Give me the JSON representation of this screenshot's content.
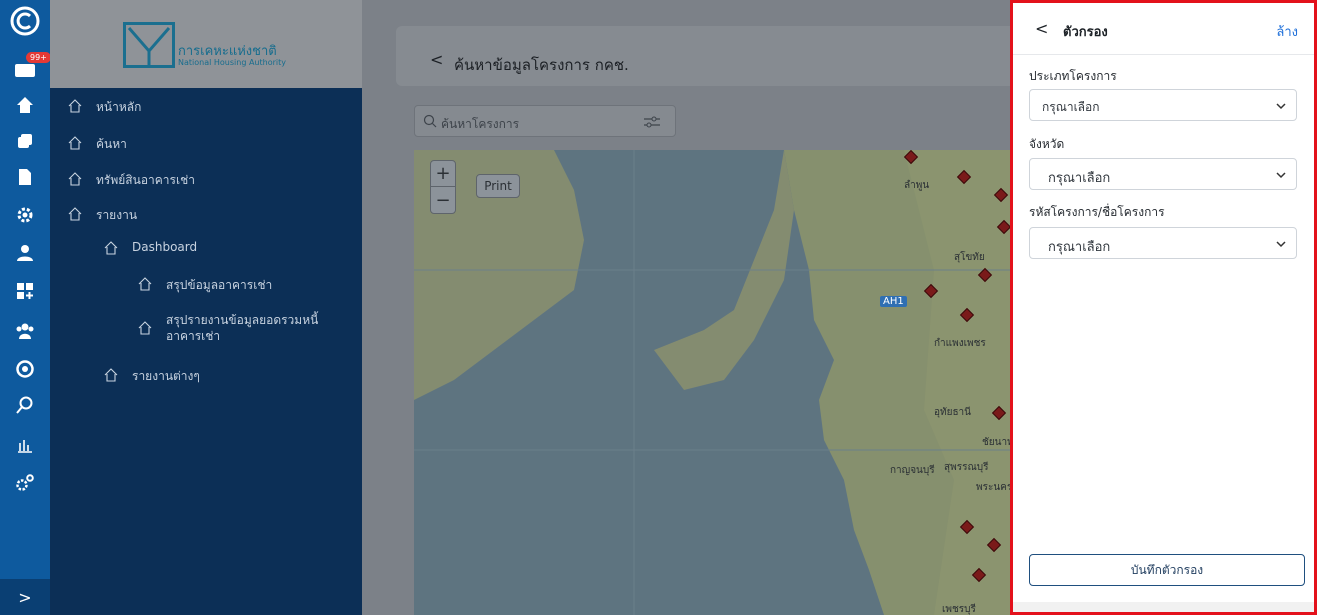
{
  "rail": {
    "badge": "99+",
    "icons": [
      "brand-c-icon",
      "inbox-icon",
      "home-icon",
      "copy-icon",
      "document-icon",
      "settings-cog-icon",
      "user-icon",
      "grid-plus-icon",
      "group-icon",
      "coin-icon",
      "search-icon",
      "bar-chart-icon",
      "gears-icon"
    ],
    "expand_label": ">"
  },
  "brand": {
    "name_th": "การเคหะแห่งชาติ",
    "name_en": "National Housing Authority"
  },
  "menu": {
    "items": [
      {
        "label": "หน้าหลัก"
      },
      {
        "label": "ค้นหา"
      },
      {
        "label": "ทรัพย์สินอาคารเช่า"
      },
      {
        "label": "รายงาน"
      },
      {
        "label": "Dashboard"
      },
      {
        "label": "สรุปข้อมูลอาคารเช่า"
      },
      {
        "label": "สรุปรายงานข้อมูลยอดรวมหนี้",
        "label2": "อาคารเช่า"
      },
      {
        "label": "รายงานต่างๆ"
      }
    ]
  },
  "page": {
    "back": "<",
    "title": "ค้นหาข้อมูลโครงการ กคช."
  },
  "search": {
    "placeholder": "ค้นหาโครงการ"
  },
  "map": {
    "zoom_in": "+",
    "zoom_out": "−",
    "print": "Print",
    "labels": [
      "ลำพูน",
      "สุโขทัย",
      "AH1",
      "กำแพงเพชร",
      "อุทัยธานี",
      "ชัยนาท",
      "กาญจนบุรี",
      "สุพรรณบุรี",
      "พระนคร",
      "เพชรบุรี"
    ]
  },
  "filter": {
    "back": "<",
    "title": "ตัวกรอง",
    "clear": "ล้าง",
    "fields": [
      {
        "label": "ประเภทโครงการ",
        "value": "กรุณาเลือก"
      },
      {
        "label": "จังหวัด",
        "value": "กรุณาเลือก"
      },
      {
        "label": "รหัสโครงการ/ชื่อโครงการ",
        "value": "กรุณาเลือก"
      }
    ],
    "save": "บันทึกตัวกรอง"
  },
  "colors": {
    "rail": "#0e5a9e",
    "menu": "#0c2f56",
    "highlight_border": "#e3111b",
    "link": "#1e6fd9"
  }
}
